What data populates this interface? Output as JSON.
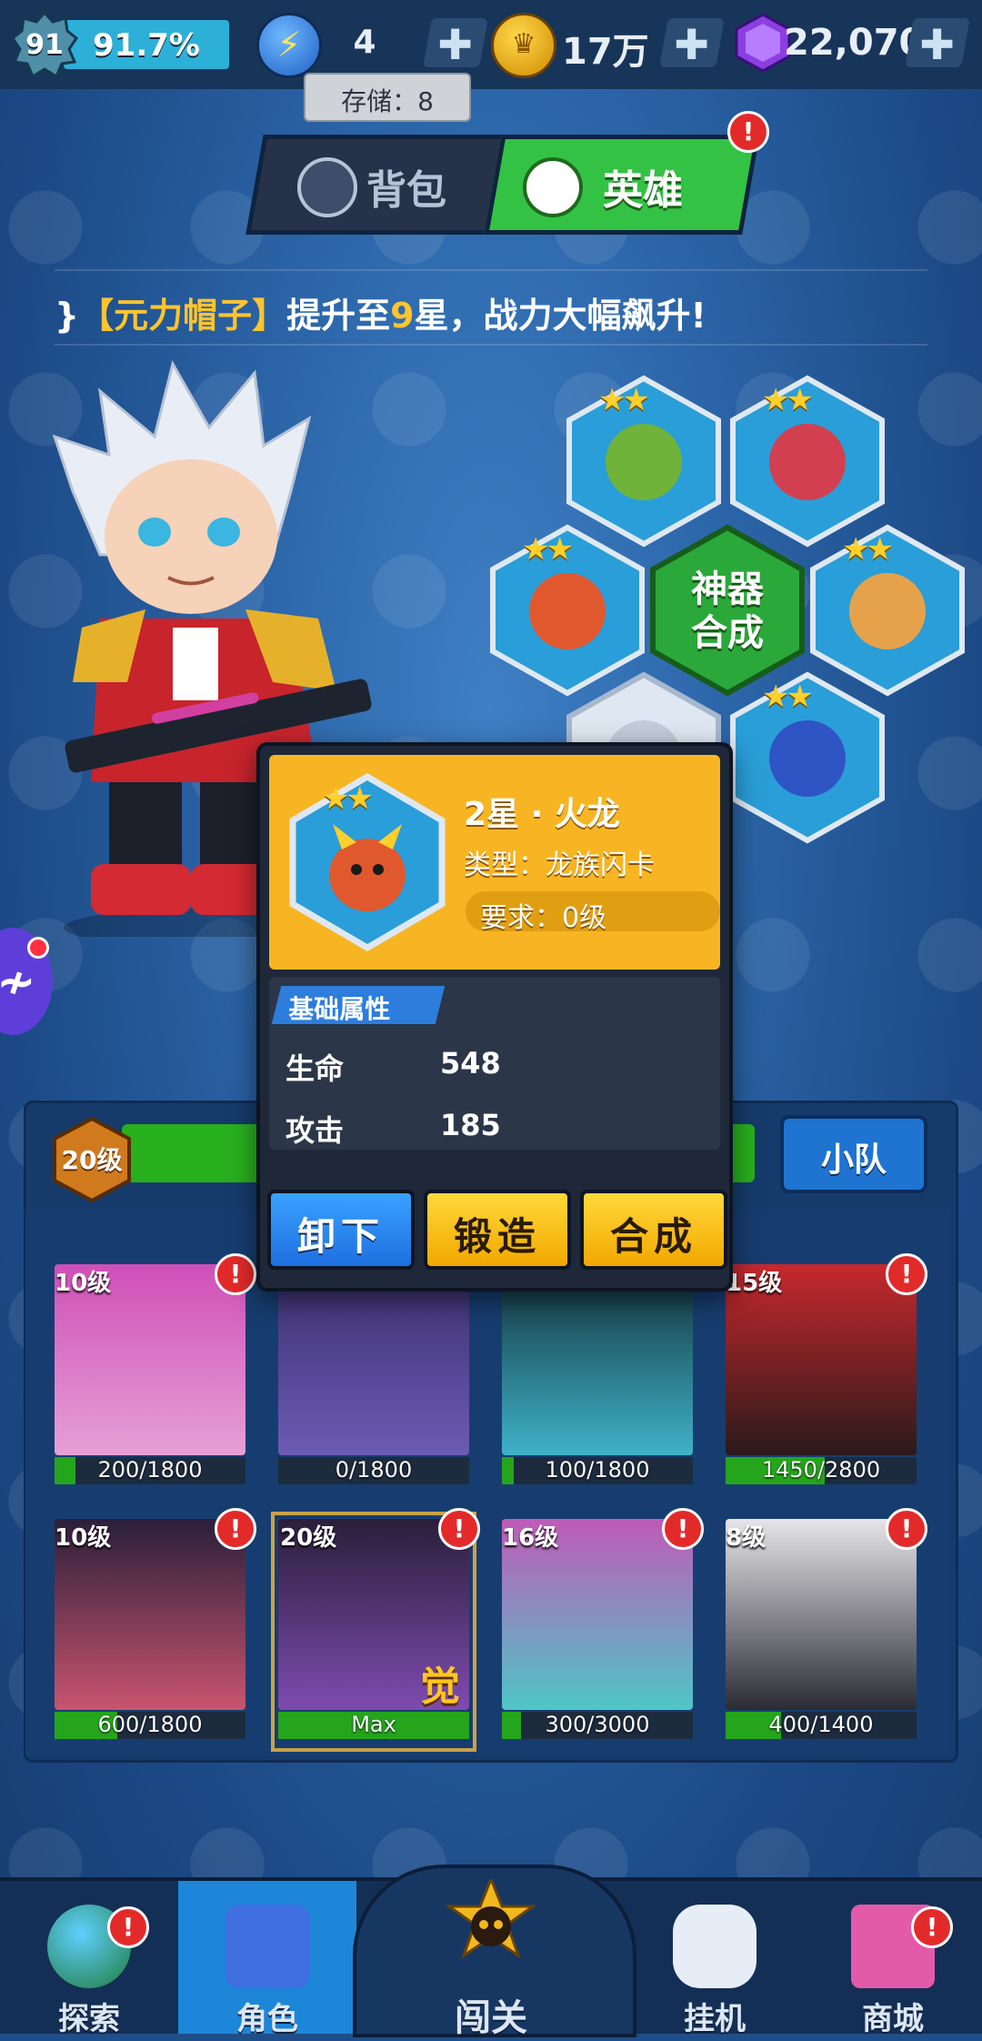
{
  "topbar": {
    "player_level": "91",
    "xp_percent": "91.7%",
    "energy_value": "4",
    "energy_storage": "存储：8",
    "gold_value": "17万",
    "gem_value": "22,070",
    "plus_symbol": "✚"
  },
  "tabs": [
    {
      "label": "背包",
      "active": false
    },
    {
      "label": "英雄",
      "active": true,
      "alert": "!"
    }
  ],
  "marquee": {
    "prefix": "}",
    "highlight_item": "【元力帽子】",
    "text_before_star": "提升至",
    "star_count": "9",
    "text_after_star": "星，战力大幅飙升!"
  },
  "artifact_grid": {
    "center_label_line1": "神器",
    "center_label_line2": "合成",
    "slots": [
      {
        "icon": "green-goblin-icon",
        "stars": "★★"
      },
      {
        "icon": "red-demon-icon",
        "stars": "★★"
      },
      {
        "icon": "fire-dragon-icon",
        "stars": "★★"
      },
      {
        "icon": "hooded-warrior-icon",
        "stars": "★★"
      },
      {
        "icon": "empty-slot-icon",
        "stars": ""
      },
      {
        "icon": "blue-robot-icon",
        "stars": "★★"
      }
    ]
  },
  "popup": {
    "stars": "★★",
    "name": "2星 · 火龙",
    "type": "类型：龙族闪卡",
    "requirement": "要求：0级",
    "attr_title": "基础属性",
    "attrs": [
      {
        "label": "生命",
        "value": "548"
      },
      {
        "label": "攻击",
        "value": "185"
      }
    ],
    "buttons": {
      "unequip": "卸下",
      "forge": "锻造",
      "merge": "合成"
    }
  },
  "squad": {
    "level": "20级",
    "button": "小队"
  },
  "heroes": [
    {
      "level": "10级",
      "progress": "200/1800",
      "fill": 0.11,
      "alert": "!",
      "portrait": "pink-hair-hero"
    },
    {
      "level": "",
      "progress": "0/1800",
      "fill": 0,
      "alert": "",
      "portrait": "purple-cap-hero"
    },
    {
      "level": "",
      "progress": "100/1800",
      "fill": 0.06,
      "alert": "",
      "portrait": "goggles-hero"
    },
    {
      "level": "15级",
      "progress": "1450/2800",
      "fill": 0.52,
      "alert": "!",
      "portrait": "red-hat-hero"
    },
    {
      "level": "10级",
      "progress": "600/1800",
      "fill": 0.33,
      "alert": "!",
      "portrait": "horned-girl-hero"
    },
    {
      "level": "20级",
      "progress": "Max",
      "fill": 1,
      "alert": "!",
      "portrait": "dark-hair-hero",
      "awaken": "觉",
      "selected": true
    },
    {
      "level": "16级",
      "progress": "300/3000",
      "fill": 0.1,
      "alert": "!",
      "portrait": "teal-hair-hero"
    },
    {
      "level": "8级",
      "progress": "400/1400",
      "fill": 0.29,
      "alert": "!",
      "portrait": "visor-hero"
    }
  ],
  "bottom_nav": [
    {
      "label": "探索",
      "icon": "globe-icon",
      "alert": "!",
      "active": false
    },
    {
      "label": "角色",
      "icon": "character-cards-icon",
      "alert": "",
      "active": true
    },
    {
      "label": "闯关",
      "icon": "skull-badge-icon",
      "alert": "",
      "active": false
    },
    {
      "label": "挂机",
      "icon": "gamepad-icon",
      "alert": "",
      "active": false
    },
    {
      "label": "商城",
      "icon": "shop-icon",
      "alert": "!",
      "active": false
    }
  ],
  "colors": {
    "background": "#2b65a8",
    "accent_green": "#34c244",
    "accent_gold": "#f7b523",
    "alert_red": "#e32a2a",
    "nav_active": "#1d86d9"
  }
}
